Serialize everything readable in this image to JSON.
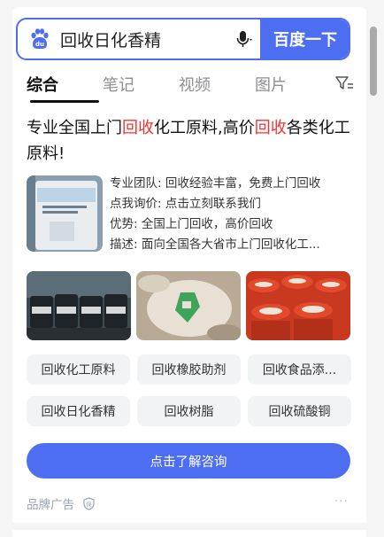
{
  "search": {
    "query": "回收日化香精",
    "button_label": "百度一下"
  },
  "tabs": [
    {
      "label": "综合",
      "active": true
    },
    {
      "label": "笔记",
      "active": false
    },
    {
      "label": "视频",
      "active": false
    },
    {
      "label": "图片",
      "active": false
    }
  ],
  "ad": {
    "title_parts": [
      "专业全国上门",
      "回收",
      "化工原料,高价",
      "回收",
      "各类化工原料!"
    ],
    "desc": [
      "专业团队: 回收经验丰富，免费上门回收",
      "点我询价: 点击立刻联系我们",
      "优势: 全国上门回收，高价回收",
      "描述: 面向全国各大省市上门回收化工..."
    ],
    "chips": [
      "回收化工原料",
      "回收橡胶助剂",
      "回收食品添...",
      "回收日化香精",
      "回收树脂",
      "回收硫酸铜"
    ],
    "cta_label": "点击了解咨询",
    "brand_label": "品牌广告",
    "more_label": "···"
  },
  "colors": {
    "accent": "#4e6ef2",
    "highlight": "#f73131"
  }
}
